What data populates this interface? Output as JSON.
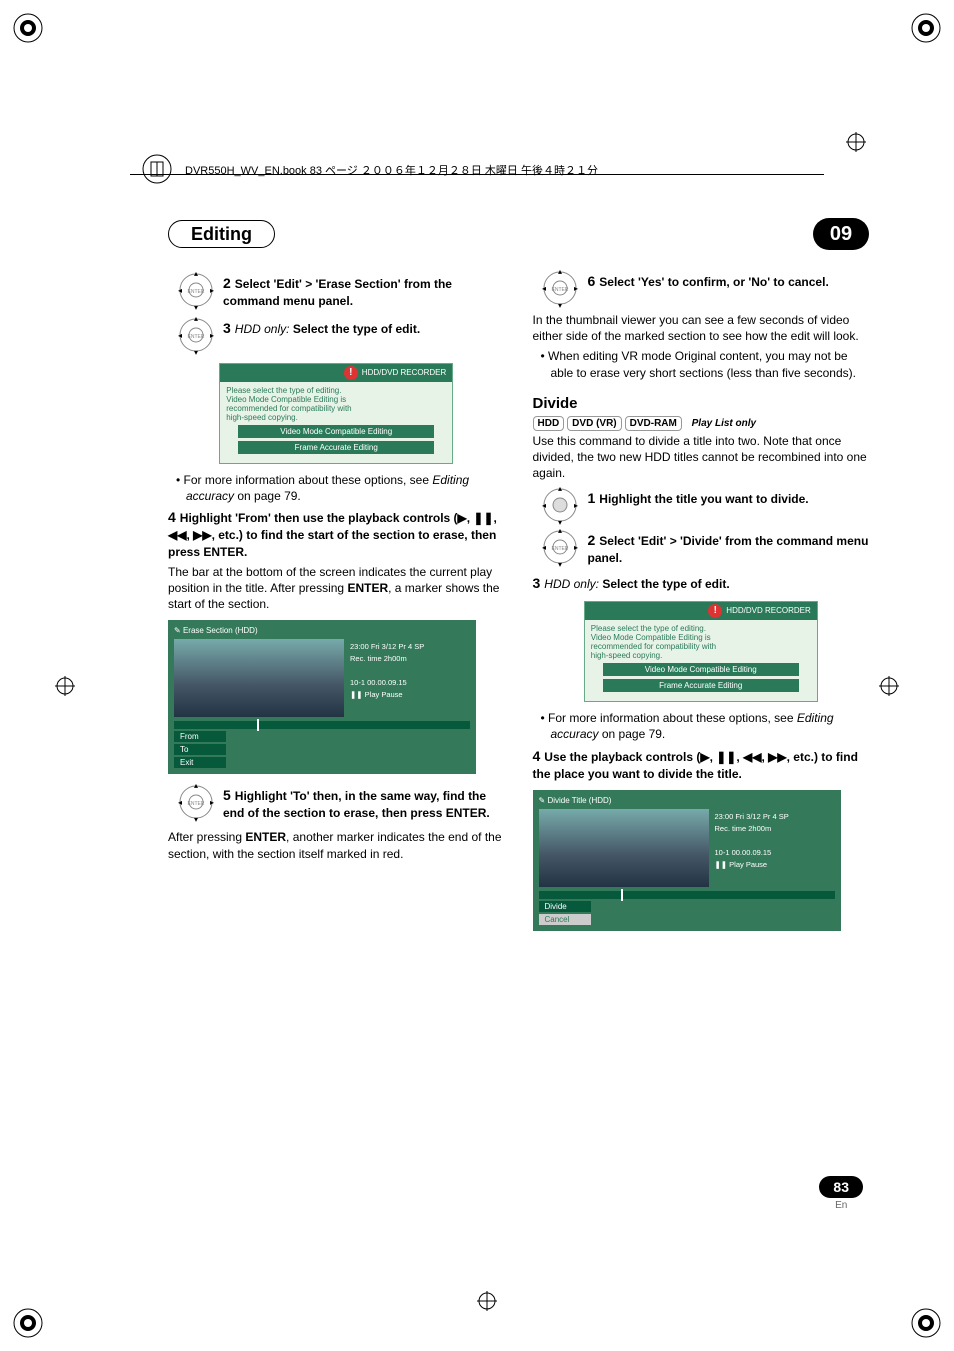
{
  "booktab": "DVR550H_WV_EN.book 83 ページ ２００６年１２月２８日 木曜日 午後４時２１分",
  "header": {
    "title": "Editing",
    "chapter": "09"
  },
  "left": {
    "step2": {
      "num": "2",
      "text": "Select 'Edit' > 'Erase Section' from the command menu panel."
    },
    "step3": {
      "num": "3",
      "prefix": "HDD only:",
      "text": " Select the type of edit."
    },
    "dlg1": {
      "title": "HDD/DVD RECORDER",
      "body": "Please select the type of editing.\nVideo Mode Compatible Editing is\nrecommended for compatibility with\nhigh-speed copying.",
      "opt1": "Video Mode Compatible Editing",
      "opt2": "Frame Accurate Editing"
    },
    "bullet1": "For more information about these options, see ",
    "bullet1i": "Editing accuracy",
    "bullet1b": " on page 79.",
    "step4": {
      "num": "4",
      "text": "Highlight 'From' then use the playback controls (▶, ❚❚, ◀◀, ▶▶, etc.) to find the start of the section to erase, then press ENTER."
    },
    "para4": "The bar at the bottom of the screen indicates the current play position in the title. After pressing ",
    "para4b": "ENTER",
    "para4c": ", a marker shows the start of the section.",
    "scr1": {
      "top": "Erase Section (HDD)",
      "r1": "23:00 Fri  3/12  Pr 4   SP",
      "r2": "Rec. time          2h00m",
      "r3": "10-1    00.00.09.15",
      "r4": "❚❚ Play Pause",
      "b1": "From",
      "b2": "To",
      "b3": "Exit"
    },
    "step5": {
      "num": "5",
      "text": "Highlight 'To' then, in the same way, find the end of the section to erase, then press ENTER."
    },
    "para5": "After pressing ",
    "para5b": "ENTER",
    "para5c": ", another marker indicates the end of the section, with the section itself marked in red."
  },
  "right": {
    "step6": {
      "num": "6",
      "text": "Select 'Yes' to confirm, or 'No' to cancel."
    },
    "para6": "In the thumbnail viewer you can see a few seconds of video either side of the marked section to see how the edit will look.",
    "bullet6": "When editing VR mode Original content, you may not be able to erase very short sections (less than five seconds).",
    "divide": {
      "h": "Divide",
      "tags": [
        "HDD",
        "DVD (VR)",
        "DVD-RAM"
      ],
      "tagsi": "Play List only",
      "intro": "Use this command to divide a title into two. Note that once divided, the two new HDD titles cannot be recombined into one again."
    },
    "dstep1": {
      "num": "1",
      "text": "Highlight the title you want to divide."
    },
    "dstep2": {
      "num": "2",
      "text": "Select 'Edit' > 'Divide' from the command menu panel."
    },
    "dstep3": {
      "num": "3",
      "prefix": "HDD only:",
      "text": " Select the type of edit."
    },
    "dlg2": {
      "title": "HDD/DVD RECORDER",
      "body": "Please select the type of editing.\nVideo Mode Compatible Editing is\nrecommended for compatibility with\nhigh-speed copying.",
      "opt1": "Video Mode Compatible Editing",
      "opt2": "Frame Accurate Editing"
    },
    "bullet3": "For more information about these options, see ",
    "bullet3i": "Editing accuracy",
    "bullet3b": " on page 79.",
    "dstep4": {
      "num": "4",
      "text": "Use the playback controls (▶, ❚❚, ◀◀, ▶▶, etc.) to find the place you want to divide the title."
    },
    "scr2": {
      "top": "Divide Title (HDD)",
      "r1": "23:00 Fri  3/12  Pr 4   SP",
      "r2": "Rec. time          2h00m",
      "r3": "10-1    00.00.09.15",
      "r4": "❚❚ Play Pause",
      "b1": "Divide",
      "b2": "Cancel"
    }
  },
  "page": {
    "num": "83",
    "lang": "En"
  }
}
